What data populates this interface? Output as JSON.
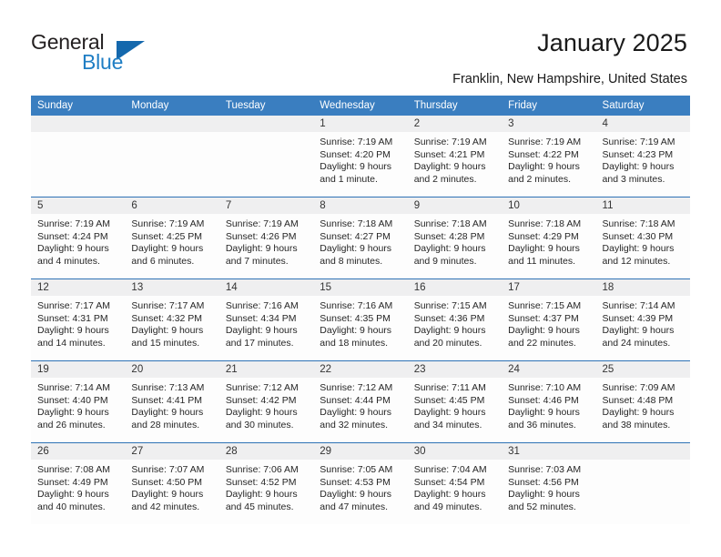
{
  "brand": {
    "name_part1": "General",
    "name_part2": "Blue",
    "logo_icon": "triangle-logo-icon",
    "accent_color": "#1468ad"
  },
  "header": {
    "title": "January 2025",
    "location": "Franklin, New Hampshire, United States"
  },
  "calendar": {
    "header_bg_color": "#3a7ec0",
    "row_divider_color": "#2e72b5",
    "daynum_band_color": "#efeff0",
    "weekday_headers": [
      "Sunday",
      "Monday",
      "Tuesday",
      "Wednesday",
      "Thursday",
      "Friday",
      "Saturday"
    ],
    "labels": {
      "sunrise": "Sunrise:",
      "sunset": "Sunset:",
      "daylight": "Daylight:"
    },
    "weeks": [
      [
        {
          "day": "",
          "sunrise": "",
          "sunset": "",
          "daylight": ""
        },
        {
          "day": "",
          "sunrise": "",
          "sunset": "",
          "daylight": ""
        },
        {
          "day": "",
          "sunrise": "",
          "sunset": "",
          "daylight": ""
        },
        {
          "day": "1",
          "sunrise": "Sunrise: 7:19 AM",
          "sunset": "Sunset: 4:20 PM",
          "daylight": "Daylight: 9 hours and 1 minute."
        },
        {
          "day": "2",
          "sunrise": "Sunrise: 7:19 AM",
          "sunset": "Sunset: 4:21 PM",
          "daylight": "Daylight: 9 hours and 2 minutes."
        },
        {
          "day": "3",
          "sunrise": "Sunrise: 7:19 AM",
          "sunset": "Sunset: 4:22 PM",
          "daylight": "Daylight: 9 hours and 2 minutes."
        },
        {
          "day": "4",
          "sunrise": "Sunrise: 7:19 AM",
          "sunset": "Sunset: 4:23 PM",
          "daylight": "Daylight: 9 hours and 3 minutes."
        }
      ],
      [
        {
          "day": "5",
          "sunrise": "Sunrise: 7:19 AM",
          "sunset": "Sunset: 4:24 PM",
          "daylight": "Daylight: 9 hours and 4 minutes."
        },
        {
          "day": "6",
          "sunrise": "Sunrise: 7:19 AM",
          "sunset": "Sunset: 4:25 PM",
          "daylight": "Daylight: 9 hours and 6 minutes."
        },
        {
          "day": "7",
          "sunrise": "Sunrise: 7:19 AM",
          "sunset": "Sunset: 4:26 PM",
          "daylight": "Daylight: 9 hours and 7 minutes."
        },
        {
          "day": "8",
          "sunrise": "Sunrise: 7:18 AM",
          "sunset": "Sunset: 4:27 PM",
          "daylight": "Daylight: 9 hours and 8 minutes."
        },
        {
          "day": "9",
          "sunrise": "Sunrise: 7:18 AM",
          "sunset": "Sunset: 4:28 PM",
          "daylight": "Daylight: 9 hours and 9 minutes."
        },
        {
          "day": "10",
          "sunrise": "Sunrise: 7:18 AM",
          "sunset": "Sunset: 4:29 PM",
          "daylight": "Daylight: 9 hours and 11 minutes."
        },
        {
          "day": "11",
          "sunrise": "Sunrise: 7:18 AM",
          "sunset": "Sunset: 4:30 PM",
          "daylight": "Daylight: 9 hours and 12 minutes."
        }
      ],
      [
        {
          "day": "12",
          "sunrise": "Sunrise: 7:17 AM",
          "sunset": "Sunset: 4:31 PM",
          "daylight": "Daylight: 9 hours and 14 minutes."
        },
        {
          "day": "13",
          "sunrise": "Sunrise: 7:17 AM",
          "sunset": "Sunset: 4:32 PM",
          "daylight": "Daylight: 9 hours and 15 minutes."
        },
        {
          "day": "14",
          "sunrise": "Sunrise: 7:16 AM",
          "sunset": "Sunset: 4:34 PM",
          "daylight": "Daylight: 9 hours and 17 minutes."
        },
        {
          "day": "15",
          "sunrise": "Sunrise: 7:16 AM",
          "sunset": "Sunset: 4:35 PM",
          "daylight": "Daylight: 9 hours and 18 minutes."
        },
        {
          "day": "16",
          "sunrise": "Sunrise: 7:15 AM",
          "sunset": "Sunset: 4:36 PM",
          "daylight": "Daylight: 9 hours and 20 minutes."
        },
        {
          "day": "17",
          "sunrise": "Sunrise: 7:15 AM",
          "sunset": "Sunset: 4:37 PM",
          "daylight": "Daylight: 9 hours and 22 minutes."
        },
        {
          "day": "18",
          "sunrise": "Sunrise: 7:14 AM",
          "sunset": "Sunset: 4:39 PM",
          "daylight": "Daylight: 9 hours and 24 minutes."
        }
      ],
      [
        {
          "day": "19",
          "sunrise": "Sunrise: 7:14 AM",
          "sunset": "Sunset: 4:40 PM",
          "daylight": "Daylight: 9 hours and 26 minutes."
        },
        {
          "day": "20",
          "sunrise": "Sunrise: 7:13 AM",
          "sunset": "Sunset: 4:41 PM",
          "daylight": "Daylight: 9 hours and 28 minutes."
        },
        {
          "day": "21",
          "sunrise": "Sunrise: 7:12 AM",
          "sunset": "Sunset: 4:42 PM",
          "daylight": "Daylight: 9 hours and 30 minutes."
        },
        {
          "day": "22",
          "sunrise": "Sunrise: 7:12 AM",
          "sunset": "Sunset: 4:44 PM",
          "daylight": "Daylight: 9 hours and 32 minutes."
        },
        {
          "day": "23",
          "sunrise": "Sunrise: 7:11 AM",
          "sunset": "Sunset: 4:45 PM",
          "daylight": "Daylight: 9 hours and 34 minutes."
        },
        {
          "day": "24",
          "sunrise": "Sunrise: 7:10 AM",
          "sunset": "Sunset: 4:46 PM",
          "daylight": "Daylight: 9 hours and 36 minutes."
        },
        {
          "day": "25",
          "sunrise": "Sunrise: 7:09 AM",
          "sunset": "Sunset: 4:48 PM",
          "daylight": "Daylight: 9 hours and 38 minutes."
        }
      ],
      [
        {
          "day": "26",
          "sunrise": "Sunrise: 7:08 AM",
          "sunset": "Sunset: 4:49 PM",
          "daylight": "Daylight: 9 hours and 40 minutes."
        },
        {
          "day": "27",
          "sunrise": "Sunrise: 7:07 AM",
          "sunset": "Sunset: 4:50 PM",
          "daylight": "Daylight: 9 hours and 42 minutes."
        },
        {
          "day": "28",
          "sunrise": "Sunrise: 7:06 AM",
          "sunset": "Sunset: 4:52 PM",
          "daylight": "Daylight: 9 hours and 45 minutes."
        },
        {
          "day": "29",
          "sunrise": "Sunrise: 7:05 AM",
          "sunset": "Sunset: 4:53 PM",
          "daylight": "Daylight: 9 hours and 47 minutes."
        },
        {
          "day": "30",
          "sunrise": "Sunrise: 7:04 AM",
          "sunset": "Sunset: 4:54 PM",
          "daylight": "Daylight: 9 hours and 49 minutes."
        },
        {
          "day": "31",
          "sunrise": "Sunrise: 7:03 AM",
          "sunset": "Sunset: 4:56 PM",
          "daylight": "Daylight: 9 hours and 52 minutes."
        },
        {
          "day": "",
          "sunrise": "",
          "sunset": "",
          "daylight": ""
        }
      ]
    ]
  }
}
